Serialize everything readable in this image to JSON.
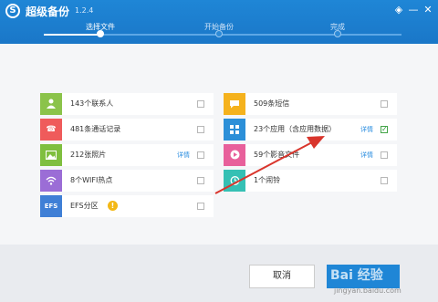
{
  "header": {
    "title": "超级备份",
    "version": "1.2.4",
    "steps": [
      {
        "label": "选择文件",
        "active": true
      },
      {
        "label": "开始备份",
        "active": false
      },
      {
        "label": "完成",
        "active": false
      }
    ]
  },
  "items_left": [
    {
      "label": "143个联系人",
      "icon": "contacts-icon",
      "color": "#8bc34a",
      "checked": false
    },
    {
      "label": "481条通话记录",
      "icon": "phone-icon",
      "color": "#ef5b5b",
      "checked": false
    },
    {
      "label": "212张照片",
      "icon": "photo-icon",
      "color": "#7fbf3f",
      "checked": false,
      "detail": "详情"
    },
    {
      "label": "8个WIFI热点",
      "icon": "wifi-icon",
      "color": "#9b6dd6",
      "checked": false
    },
    {
      "label": "EFS分区",
      "icon": "efs-icon",
      "tile_text": "EFS",
      "color": "#3f7fd6",
      "checked": false
    }
  ],
  "items_right": [
    {
      "label": "509条短信",
      "icon": "sms-icon",
      "color": "#f5b21d",
      "checked": false
    },
    {
      "label": "23个应用（含应用数据）",
      "icon": "apps-icon",
      "color": "#2c8fd8",
      "checked": true,
      "detail": "详情"
    },
    {
      "label": "59个影音文件",
      "icon": "media-icon",
      "color": "#e8609b",
      "checked": false,
      "detail": "详情"
    },
    {
      "label": "1个闹铃",
      "icon": "alarm-icon",
      "color": "#35c0b4",
      "checked": false
    }
  ],
  "footer": {
    "cancel_label": "取消",
    "next_label": ""
  },
  "watermark": {
    "text": "Bai 经验",
    "url": "jingyan.baidu.com"
  },
  "colors": {
    "header": "#1f86d6",
    "check": "#43a447",
    "link": "#2a8de0",
    "arrow": "#d9352c"
  }
}
